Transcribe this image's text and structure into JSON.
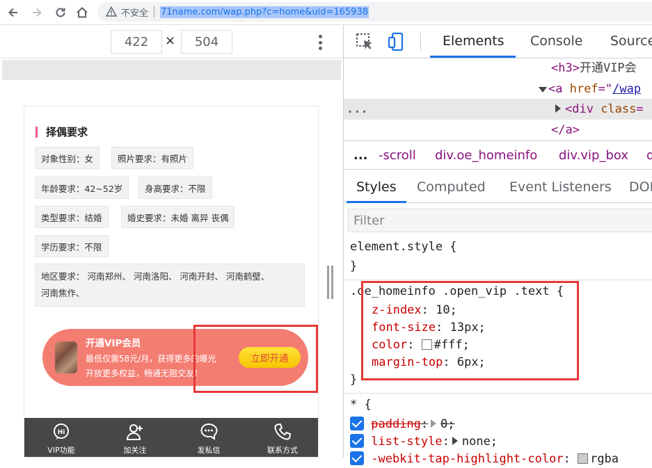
{
  "browser": {
    "insecure_label": "不安全",
    "url": "71name.com/wap.php?c=home&uid=165938",
    "accent": "#1a73e8"
  },
  "device": {
    "width": "422",
    "height": "504",
    "times": "×"
  },
  "page": {
    "section_title": "择偶要求",
    "tags": [
      "对象性别：女",
      "照片要求：有照片",
      "年龄要求：42~52岁",
      "身高要求：不限",
      "类型要求：结婚",
      "婚史要求：未婚  离异  丧偶",
      "学历要求：不限"
    ],
    "region": {
      "line1": "地区要求： 河南郑州、 河南洛阳、 河南开封、 河南鹤壁、",
      "line2": "河南焦作、"
    },
    "vip": {
      "title": "开通VIP会员",
      "line1": "最低仅需58元/月，获得更多的曝光",
      "line2": "开放更多权益，畅通无阻交友！",
      "button": "立即开通",
      "banner_color": "#f47d72"
    },
    "nav": [
      {
        "label": "VIP功能",
        "icon": "vip-icon"
      },
      {
        "label": "加关注",
        "icon": "add-user-icon"
      },
      {
        "label": "发私信",
        "icon": "message-icon"
      },
      {
        "label": "联系方式",
        "icon": "phone-icon"
      }
    ]
  },
  "devtools": {
    "tabs": [
      "Elements",
      "Console",
      "Source"
    ],
    "dom": {
      "l1_tag": "<h3>",
      "l1_text": "开通VIP会",
      "l2_tag": "<a ",
      "l2_attr": "href",
      "l2_eq": "=\"",
      "l2_val": "/wap",
      "l3_tag": "<div ",
      "l3_attr": "class",
      "l3_eq": "=",
      "l4_tag": "</a>",
      "ellipsis": "..."
    },
    "breadcrumbs": [
      "...",
      "-scroll",
      "div.oe_homeinfo",
      "div.vip_box",
      "d"
    ],
    "subtabs": [
      "Styles",
      "Computed",
      "Event Listeners",
      "DOI"
    ],
    "filter_placeholder": "Filter",
    "rules": {
      "element_style": "element.style {",
      "close": "}",
      "selector": ".oe_homeinfo .open_vip .text",
      "open": " {",
      "props": [
        {
          "name": "z-index",
          "value": "10;"
        },
        {
          "name": "font-size",
          "value": "13px;"
        },
        {
          "name": "color",
          "value": "#fff;"
        },
        {
          "name": "margin-top",
          "value": "6px;"
        }
      ],
      "universal": "* {",
      "u_props": [
        {
          "name": "padding",
          "value": "0;"
        },
        {
          "name": "list-style",
          "value": "none;"
        },
        {
          "name": "-webkit-tap-highlight-color",
          "value": "rgba"
        }
      ]
    }
  }
}
